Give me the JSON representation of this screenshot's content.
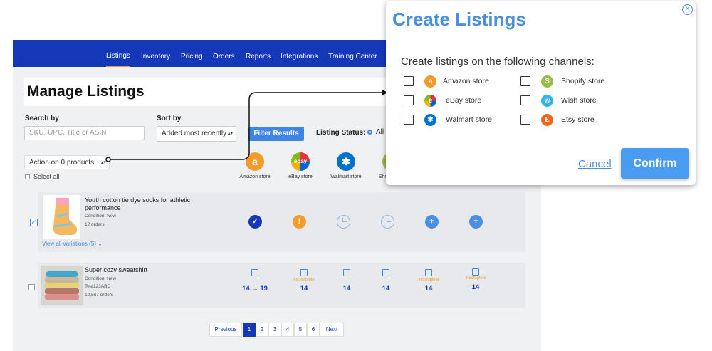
{
  "nav": {
    "items": [
      "Listings",
      "Inventory",
      "Pricing",
      "Orders",
      "Reports",
      "Integrations",
      "Training Center"
    ],
    "active": "Listings"
  },
  "page": {
    "title": "Manage Listings"
  },
  "filters": {
    "search_label": "Search by",
    "search_placeholder": "SKU, UPC, Title or ASIN",
    "sort_label": "Sort by",
    "sort_value": "Added most recently",
    "filter_button": "Filter Results",
    "status_label": "Listing Status:",
    "status_value": "All"
  },
  "actions": {
    "action_select": "Action on 0 products",
    "select_all": "Select all"
  },
  "channels": [
    {
      "name": "Amazon store",
      "icon": "amazon-icon",
      "color": "#f39c2c",
      "glyph": "a"
    },
    {
      "name": "eBay store",
      "icon": "ebay-icon",
      "color": "#e53238",
      "glyph": "ebay"
    },
    {
      "name": "Walmart store",
      "icon": "walmart-icon",
      "color": "#0071ce",
      "glyph": "✱"
    },
    {
      "name": "Sho",
      "icon": "shopify-icon",
      "color": "#95bf47",
      "glyph": ""
    }
  ],
  "products": [
    {
      "title": "Youth cotton tie dye socks for athletic performance",
      "condition": "Condition: New",
      "orders": "12 orders",
      "variations": "View all variations (5)",
      "checked": true,
      "statuses": [
        "listed",
        "warning",
        "pending",
        "pending",
        "add",
        "add"
      ]
    },
    {
      "title": "Super cozy sweatshirt",
      "condition": "Condition: New",
      "sku": "Test123ABC",
      "orders": "12,567 orders",
      "checked": false,
      "quantities": [
        "14 → 19",
        "14",
        "14",
        "14",
        "14",
        "14"
      ],
      "incomplete_label": "Incomplete",
      "incomplete": [
        false,
        true,
        false,
        false,
        true,
        true
      ]
    }
  ],
  "pagination": {
    "previous": "Previous",
    "pages": [
      "1",
      "2",
      "3",
      "4",
      "5",
      "6"
    ],
    "current": "1",
    "next": "Next"
  },
  "modal": {
    "title": "Create Listings",
    "subtitle": "Create listings on the following channels:",
    "channels": [
      {
        "name": "Amazon store",
        "icon": "amazon-icon",
        "color": "#f39c2c",
        "glyph": "a"
      },
      {
        "name": "Shopify store",
        "icon": "shopify-icon",
        "color": "#95bf47",
        "glyph": "S"
      },
      {
        "name": "eBay store",
        "icon": "ebay-icon",
        "color": "#3a7be0",
        "glyph": "e"
      },
      {
        "name": "Wish store",
        "icon": "wish-icon",
        "color": "#2fb7ec",
        "glyph": "w"
      },
      {
        "name": "Walmart store",
        "icon": "walmart-icon",
        "color": "#0071ce",
        "glyph": "✱"
      },
      {
        "name": "Etsy store",
        "icon": "etsy-icon",
        "color": "#f1641e",
        "glyph": "E"
      }
    ],
    "cancel": "Cancel",
    "confirm": "Confirm"
  }
}
